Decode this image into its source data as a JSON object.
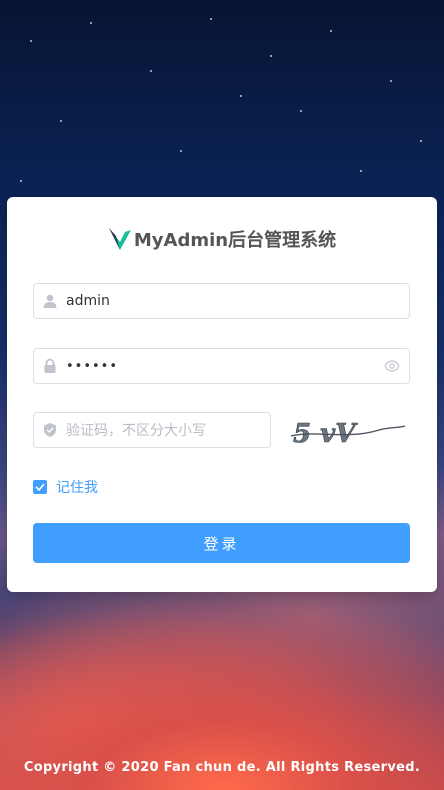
{
  "app": {
    "title": "MyAdmin后台管理系统"
  },
  "form": {
    "username_value": "admin",
    "password_value": "••••••",
    "captcha_placeholder": "验证码，不区分大小写",
    "captcha_text": "5 vV",
    "remember_label": "记住我",
    "remember_checked": true,
    "login_label": "登录"
  },
  "footer": {
    "copyright": "Copyright © 2020 Fan chun de. All Rights Reserved."
  },
  "colors": {
    "primary": "#409eff",
    "logo": "#1abc9c"
  },
  "icons": [
    "user-icon",
    "lock-icon",
    "eye-icon",
    "shield-icon",
    "check-icon",
    "logo-icon"
  ]
}
